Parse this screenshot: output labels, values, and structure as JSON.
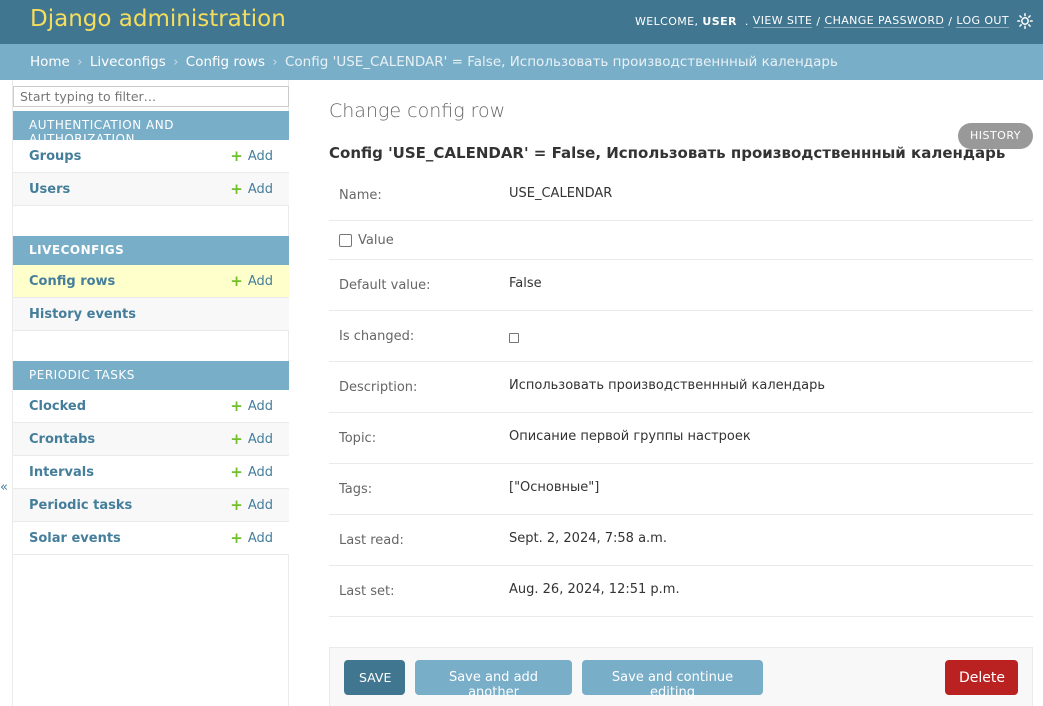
{
  "header": {
    "branding": "Django administration",
    "welcome": "WELCOME,",
    "user": "USER",
    "view_site": "VIEW SITE",
    "change_password": "CHANGE PASSWORD",
    "log_out": "LOG OUT",
    "separator": "/",
    "theme_icon": "sun-icon",
    "brand_color": "#f5dd5d",
    "header_bg": "#417690"
  },
  "breadcrumbs": {
    "home": "Home",
    "app": "Liveconfigs",
    "model": "Config rows",
    "current": "Config 'USE_CALENDAR' = False, Использовать производственнный календарь",
    "arrow": "›"
  },
  "sidebar": {
    "filter_placeholder": "Start typing to filter…",
    "collapse_glyph": "«",
    "modules": [
      {
        "caption": "AUTHENTICATION AND AUTHORIZATION",
        "models": [
          {
            "name": "Groups",
            "add": "Add"
          },
          {
            "name": "Users",
            "add": "Add"
          }
        ]
      },
      {
        "caption": "LIVECONFIGS",
        "models": [
          {
            "name": "Config rows",
            "add": "Add"
          },
          {
            "name": "History events",
            "add": ""
          }
        ]
      },
      {
        "caption": "PERIODIC TASKS",
        "models": [
          {
            "name": "Clocked",
            "add": "Add"
          },
          {
            "name": "Crontabs",
            "add": "Add"
          },
          {
            "name": "Intervals",
            "add": "Add"
          },
          {
            "name": "Periodic tasks",
            "add": "Add"
          },
          {
            "name": "Solar events",
            "add": "Add"
          }
        ]
      }
    ]
  },
  "content": {
    "title": "Change config row",
    "history": "HISTORY",
    "object_title": "Config 'USE_CALENDAR' = False, Использовать производственнный календарь",
    "fields": {
      "name": {
        "label": "Name:",
        "value": "USE_CALENDAR"
      },
      "value": {
        "label": "Value"
      },
      "default_value": {
        "label": "Default value:",
        "value": "False"
      },
      "is_changed": {
        "label": "Is changed:"
      },
      "description": {
        "label": "Description:",
        "value": "Использовать производственнный календарь"
      },
      "topic": {
        "label": "Topic:",
        "value": "Описание первой группы настроек"
      },
      "tags": {
        "label": "Tags:",
        "value": "[\"Основные\"]"
      },
      "last_read": {
        "label": "Last read:",
        "value": "Sept. 2, 2024, 7:58 a.m."
      },
      "last_set": {
        "label": "Last set:",
        "value": "Aug. 26, 2024, 12:51 p.m."
      }
    }
  },
  "submit": {
    "save": "SAVE",
    "save_add": "Save and add another",
    "save_continue": "Save and continue editing",
    "delete": "Delete"
  },
  "colors": {
    "primary": "#417690",
    "secondary": "#79aec8",
    "link": "#447e9b",
    "add_green": "#70bf2b",
    "delete_red": "#ba2121",
    "selected_row": "#ffffcc"
  }
}
